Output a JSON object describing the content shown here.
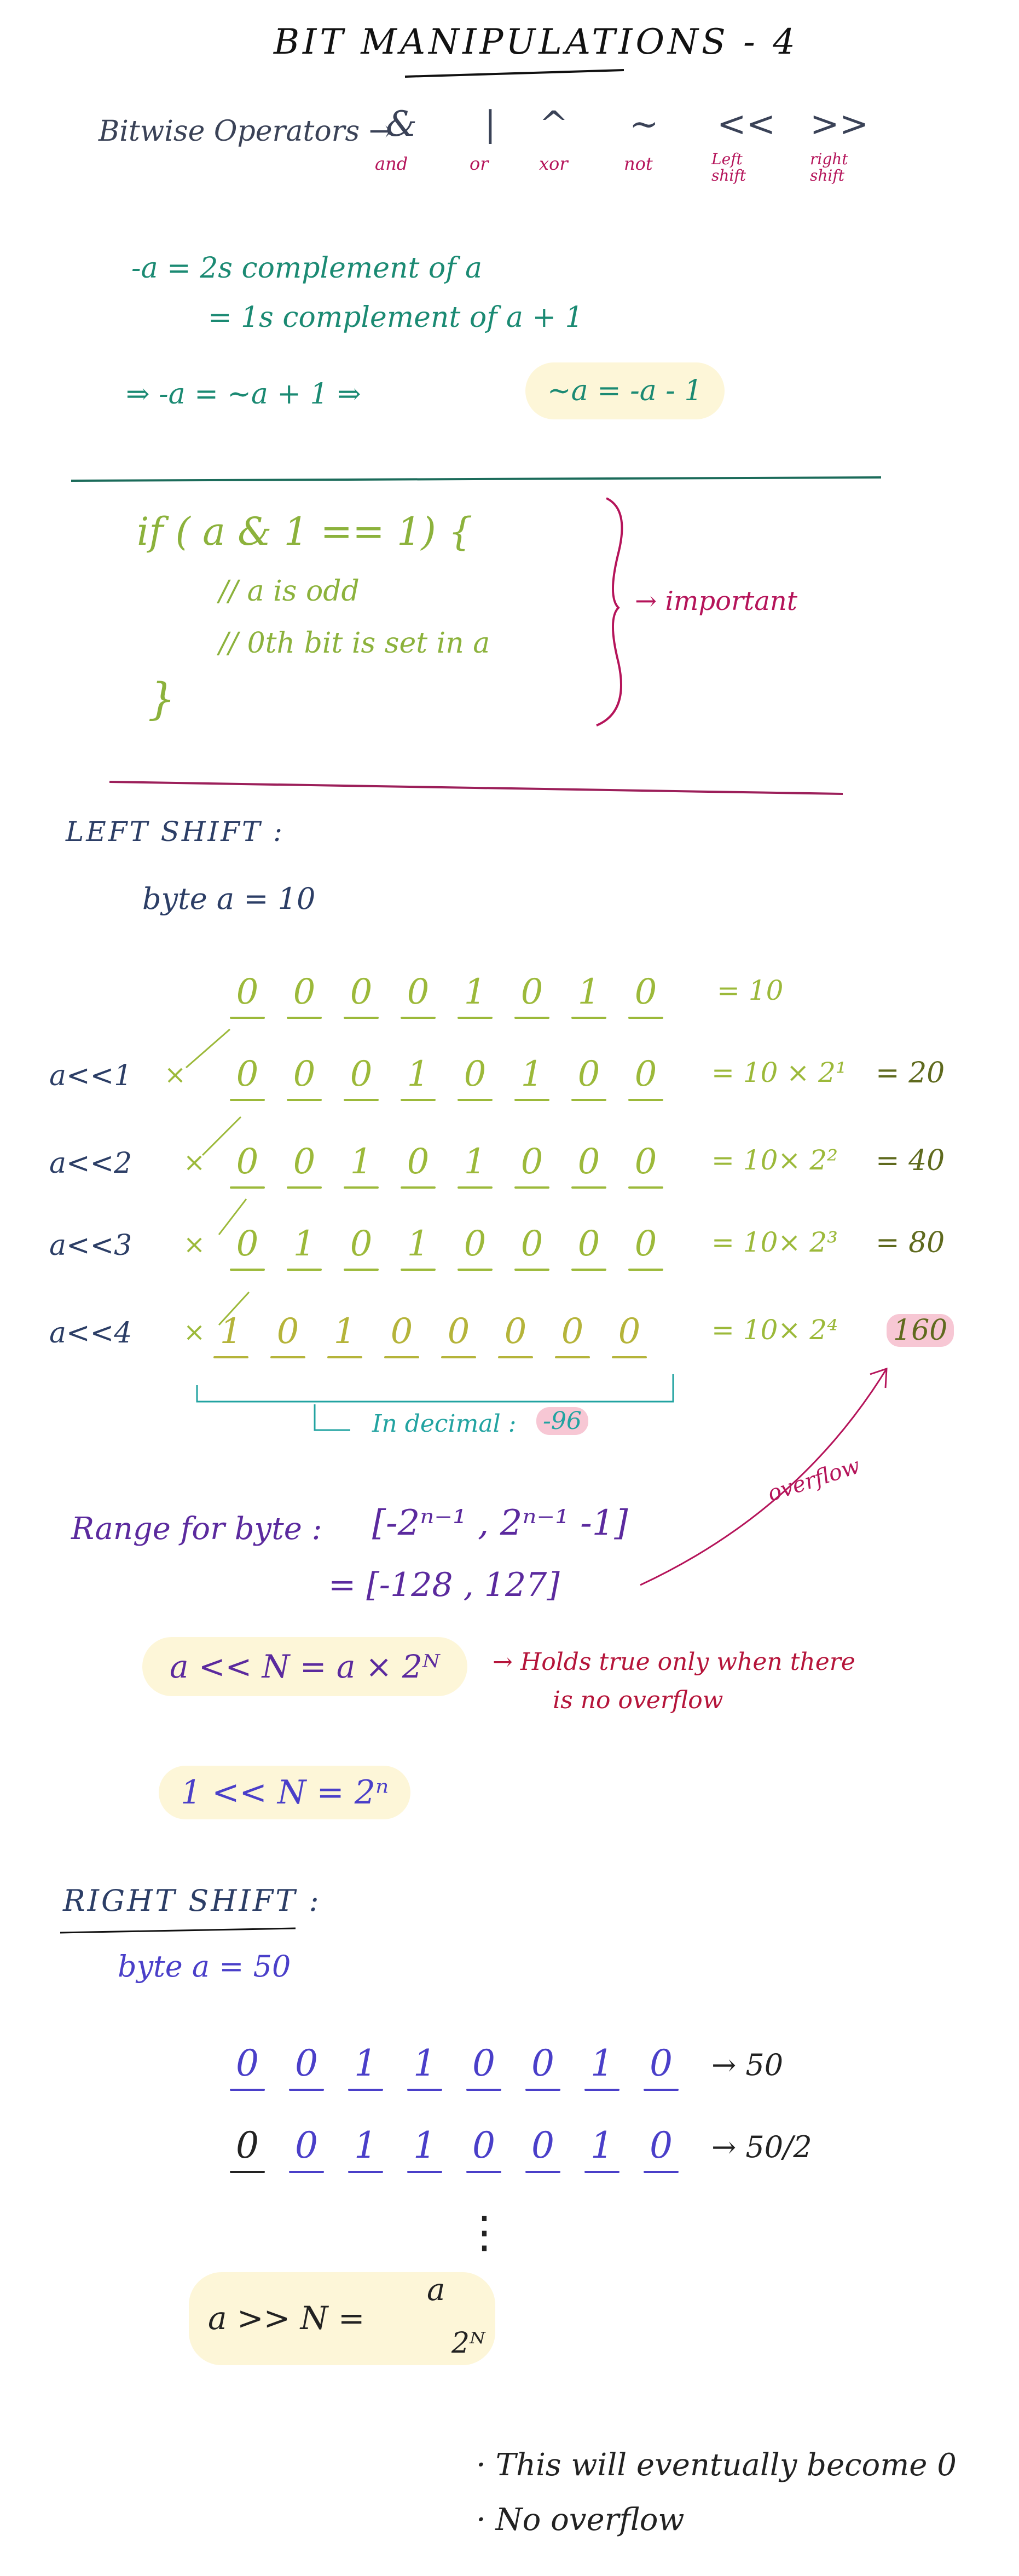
{
  "title": "BIT  MANIPULATIONS - 4",
  "operators": {
    "label": "Bitwise Operators →",
    "items": [
      {
        "symbol": "&",
        "name": "and"
      },
      {
        "symbol": "|",
        "name": "or"
      },
      {
        "symbol": "^",
        "name": "xor"
      },
      {
        "symbol": "~",
        "name": "not"
      },
      {
        "symbol": "<<",
        "name": "Left shift"
      },
      {
        "symbol": ">>",
        "name": "right shift"
      }
    ]
  },
  "complement": {
    "line1": "-a  =  2s  complement  of a",
    "line2": "=  1s  complement  of a + 1",
    "line3a": "⇒  -a  =  ~a + 1   ⇒",
    "line3b": "~a = -a - 1"
  },
  "odd_check": {
    "code1": "if ( a & 1 == 1) {",
    "code2": "// a  is  odd",
    "code3": "// 0th  bit  is  set  in  a",
    "code4": "}",
    "note": "→ important"
  },
  "left_shift": {
    "heading": "LEFT  SHIFT :",
    "decl": "byte  a = 10",
    "rows": [
      {
        "label": "",
        "bits": [
          "0",
          "0",
          "0",
          "0",
          "1",
          "0",
          "1",
          "0"
        ],
        "result_a": "= 10",
        "result_b": ""
      },
      {
        "label": "a<<1",
        "bits": [
          "0",
          "0",
          "0",
          "1",
          "0",
          "1",
          "0",
          "0"
        ],
        "result_a": "= 10 × 2¹",
        "result_b": "= 20"
      },
      {
        "label": "a<<2",
        "bits": [
          "0",
          "0",
          "1",
          "0",
          "1",
          "0",
          "0",
          "0"
        ],
        "result_a": "= 10× 2²",
        "result_b": "= 40"
      },
      {
        "label": "a<<3",
        "bits": [
          "0",
          "1",
          "0",
          "1",
          "0",
          "0",
          "0",
          "0"
        ],
        "result_a": "= 10× 2³",
        "result_b": "= 80"
      },
      {
        "label": "a<<4",
        "bits": [
          "1",
          "0",
          "1",
          "0",
          "0",
          "0",
          "0",
          "0"
        ],
        "result_a": "= 10× 2⁴",
        "result_b": "160"
      }
    ],
    "dropped": "×",
    "decimal_label": "In decimal :",
    "decimal_value": "-96",
    "overflow": "overflow"
  },
  "range": {
    "label": "Range  for  byte :",
    "formula": "[-2ⁿ⁻¹ ,  2ⁿ⁻¹ -1]",
    "values": "= [-128 , 127]"
  },
  "shift_rule": {
    "formula": "a << N  =  a × 2ᴺ",
    "note1": "→  Holds  true  only  when  there",
    "note2": "is  no  overflow",
    "pow": "1 << N = 2ⁿ"
  },
  "right_shift": {
    "heading": "RIGHT  SHIFT :",
    "decl": "byte  a = 50",
    "row1": {
      "bits": [
        "0",
        "0",
        "1",
        "1",
        "0",
        "0",
        "1",
        "0"
      ],
      "result": "→ 50"
    },
    "row2": {
      "bits": [
        "0",
        "0",
        "1",
        "1",
        "0",
        "0",
        "1",
        "0"
      ],
      "result": "→ 50/2"
    },
    "ellipsis": "⋮",
    "formula_a": "a >> N  =",
    "formula_num": "a",
    "formula_den": "2ᴺ",
    "bullet1": "· This  will  eventually   become 0",
    "bullet2": "· No   overflow"
  }
}
